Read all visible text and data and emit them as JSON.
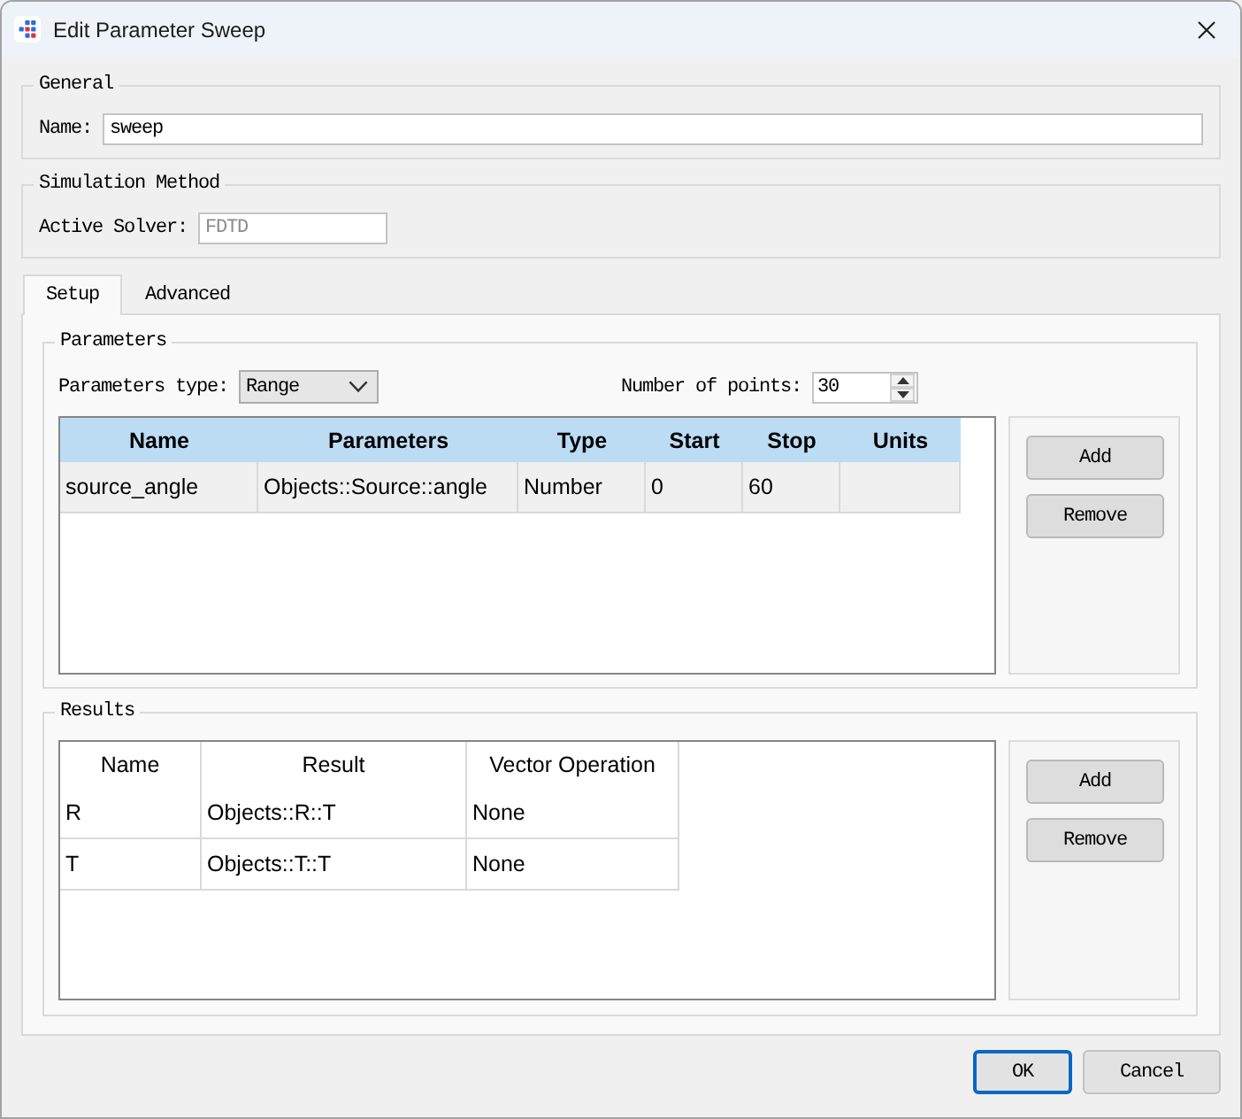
{
  "window": {
    "title": "Edit Parameter Sweep"
  },
  "general": {
    "title": "General",
    "fields": [
      {
        "kind": "text",
        "label": "Name:",
        "value": "sweep",
        "disabled": false
      }
    ]
  },
  "simulation_method": {
    "title": "Simulation Method",
    "fields": [
      {
        "kind": "text",
        "label": "Active Solver:",
        "value": "FDTD",
        "disabled": true
      }
    ]
  },
  "tabs": [
    {
      "label": "Setup",
      "selected": true
    },
    {
      "label": "Advanced",
      "selected": false
    }
  ],
  "parameters": {
    "title": "Parameters",
    "fields": [
      {
        "kind": "combo",
        "label": "Parameters type:",
        "value": "Range",
        "disabled": false
      },
      {
        "kind": "spin",
        "label": "Number of points:",
        "value": "30",
        "disabled": false
      }
    ],
    "table": {
      "columns": [
        "Name",
        "Parameters",
        "Type",
        "Start",
        "Stop",
        "Units"
      ],
      "rows": [
        {
          "cells": [
            "source_angle",
            "Objects::Source::angle",
            "Number",
            "0",
            "60"
          ],
          "selected": true
        }
      ]
    },
    "buttons": [
      "Add",
      "Remove"
    ]
  },
  "results": {
    "title": "Results",
    "table": {
      "columns": [
        "Name",
        "Result",
        "Vector Operation"
      ],
      "rows": [
        {
          "cells": [
            "R",
            "Objects::R::T",
            "None"
          ],
          "selected": false
        },
        {
          "cells": [
            "T",
            "Objects::T::T",
            "None"
          ],
          "selected": false
        }
      ]
    },
    "buttons": [
      "Add",
      "Remove"
    ]
  },
  "buttons": [
    {
      "label": "OK",
      "focused": true
    },
    {
      "label": "Cancel",
      "focused": false
    }
  ]
}
